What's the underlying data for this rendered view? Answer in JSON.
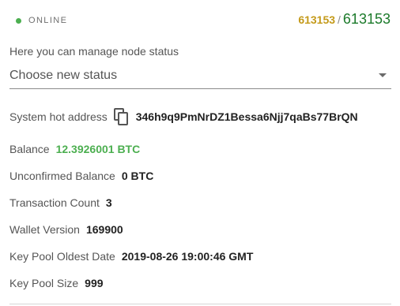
{
  "status": {
    "label": "ONLINE",
    "dot_color": "#4caf50"
  },
  "blocks": {
    "local": "613153",
    "separator": "/",
    "network": "613153",
    "local_color": "#c49a1a",
    "network_color": "#1b7a2a"
  },
  "manage": {
    "label": "Here you can manage node status",
    "select_value": "Choose new status"
  },
  "info": {
    "hot_address_label": "System hot address",
    "hot_address_value": "346h9q9PmNrDZ1Bessa6Njj7qaBs77BrQN",
    "balance_label": "Balance",
    "balance_value": "12.3926001 BTC",
    "balance_color": "#4caf50",
    "unconfirmed_label": "Unconfirmed Balance",
    "unconfirmed_value": "0 BTC",
    "tx_count_label": "Transaction Count",
    "tx_count_value": "3",
    "wallet_version_label": "Wallet Version",
    "wallet_version_value": "169900",
    "keypool_oldest_label": "Key Pool Oldest Date",
    "keypool_oldest_value": "2019-08-26 19:00:46 GMT",
    "keypool_size_label": "Key Pool Size",
    "keypool_size_value": "999"
  },
  "icons": {
    "copy": "copy-icon",
    "dropdown": "chevron-down-icon",
    "status": "status-dot-icon"
  }
}
